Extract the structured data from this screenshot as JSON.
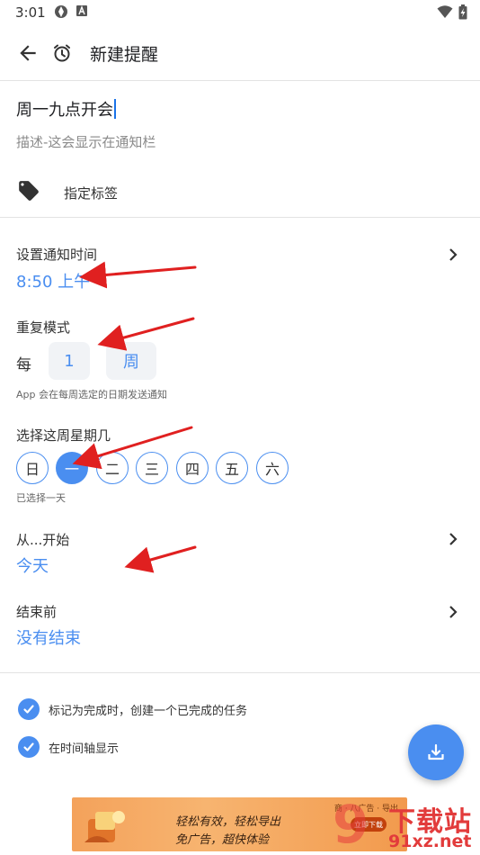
{
  "status_bar": {
    "time": "3:01",
    "icons": [
      "vpn-icon",
      "a-icon",
      "wifi-icon",
      "battery-charging-icon"
    ]
  },
  "app_bar": {
    "title": "新建提醒",
    "back_icon": "arrow-left-icon",
    "alarm_icon": "alarm-clock-icon"
  },
  "form": {
    "title_value": "周一九点开会",
    "description_placeholder": "描述-这会显示在通知栏",
    "tag_label": "指定标签"
  },
  "notification_time": {
    "label": "设置通知时间",
    "value": "8:50 上午"
  },
  "repeat": {
    "label": "重复模式",
    "prefix": "每",
    "interval": "1",
    "unit": "周",
    "hint": "App 会在每周选定的日期发送通知"
  },
  "weekdays": {
    "label": "选择这周星期几",
    "days": [
      {
        "label": "日",
        "selected": false
      },
      {
        "label": "一",
        "selected": true
      },
      {
        "label": "二",
        "selected": false
      },
      {
        "label": "三",
        "selected": false
      },
      {
        "label": "四",
        "selected": false
      },
      {
        "label": "五",
        "selected": false
      },
      {
        "label": "六",
        "selected": false
      }
    ],
    "hint": "已选择一天"
  },
  "start": {
    "label": "从...开始",
    "value": "今天"
  },
  "end": {
    "label": "结束前",
    "value": "没有结束"
  },
  "options": {
    "create_completed_task": "标记为完成时，创建一个已完成的任务",
    "show_in_timeline": "在时间轴显示",
    "create_completed_checked": true,
    "timeline_checked": true
  },
  "fab": {
    "icon": "download-tray-icon"
  },
  "ad": {
    "topline": "商 · 八广告 · 导出",
    "line1": "轻松有效，轻松导出",
    "line2": "免广告，超快体验",
    "badge": "立即下载"
  },
  "watermark": {
    "number": "9",
    "title": "下载站",
    "domain": "91xz.net"
  },
  "colors": {
    "accent": "#4a8ef0",
    "annotation_arrow": "#e02020"
  }
}
